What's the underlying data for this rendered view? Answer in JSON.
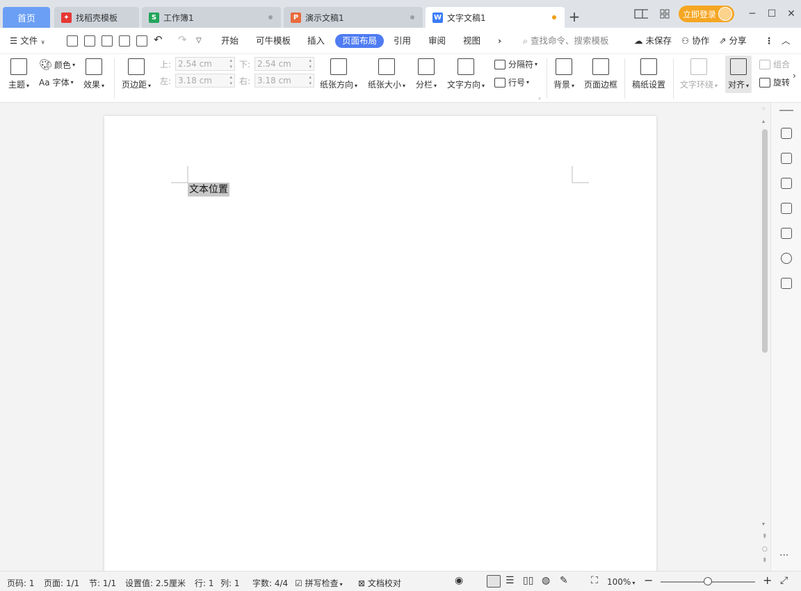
{
  "tabs": {
    "home": "首页",
    "items": [
      {
        "label": "找稻壳模板",
        "color": "#e53935",
        "glyph": "✦"
      },
      {
        "label": "工作簿1",
        "color": "#22a55a",
        "glyph": "S"
      },
      {
        "label": "演示文稿1",
        "color": "#e96a3c",
        "glyph": "P"
      },
      {
        "label": "文字文稿1",
        "color": "#3b7cf5",
        "glyph": "W"
      }
    ],
    "new_tab": "+",
    "login": "立即登录"
  },
  "menu": {
    "file": "文件",
    "items": [
      "开始",
      "可牛模板",
      "插入",
      "页面布局",
      "引用",
      "审阅",
      "视图"
    ],
    "active": "页面布局",
    "more": "›",
    "search_placeholder": "查找命令、搜索模板",
    "unsaved": "未保存",
    "collab": "协作",
    "share": "分享"
  },
  "ribbon": {
    "theme": "主题",
    "color": "颜色",
    "font": "字体",
    "effect": "效果",
    "margins": "页边距",
    "margin_top_label": "上:",
    "margin_top": "2.54 cm",
    "margin_bottom_label": "下:",
    "margin_bottom": "2.54 cm",
    "margin_left_label": "左:",
    "margin_left": "3.18 cm",
    "margin_right_label": "右:",
    "margin_right": "3.18 cm",
    "orientation": "纸张方向",
    "size": "纸张大小",
    "columns": "分栏",
    "text_direction": "文字方向",
    "breaks": "分隔符",
    "line_numbers": "行号",
    "background": "背景",
    "page_borders": "页面边框",
    "manuscript": "稿纸设置",
    "text_wrap": "文字环绕",
    "align": "对齐",
    "group": "组合",
    "rotate": "旋转"
  },
  "document": {
    "text": "文本位置"
  },
  "status": {
    "page_no": "页码: 1",
    "pages": "页面: 1/1",
    "section": "节: 1/1",
    "setting": "设置值: 2.5厘米",
    "row": "行: 1",
    "col": "列: 1",
    "word_count": "字数: 4/4",
    "spell_check": "拼写检查",
    "proofread": "文档校对",
    "zoom": "100%"
  }
}
